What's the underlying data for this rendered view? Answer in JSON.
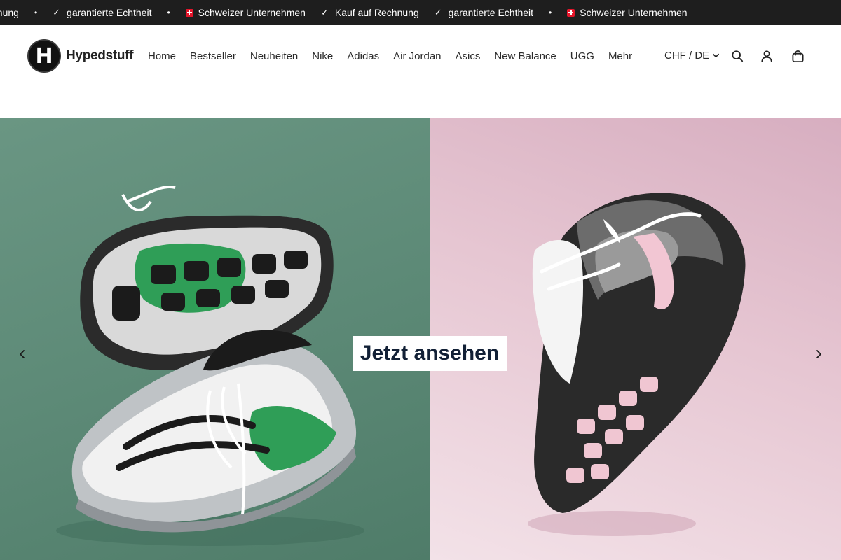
{
  "ticker": {
    "items": [
      {
        "type": "text",
        "text": "hnung"
      },
      {
        "type": "check",
        "text": "garantierte Echtheit"
      },
      {
        "type": "flag",
        "text": "Schweizer Unternehmen"
      },
      {
        "type": "check",
        "text": "Kauf auf Rechnung"
      },
      {
        "type": "check",
        "text": "garantierte Echtheit"
      },
      {
        "type": "flag",
        "text": "Schweizer Unternehmen"
      }
    ],
    "check_glyph": "✓",
    "dot_glyph": "•"
  },
  "header": {
    "logo_letter": "H",
    "logo_text": "Hypedstuff",
    "nav": [
      "Home",
      "Bestseller",
      "Neuheiten",
      "Nike",
      "Adidas",
      "Air Jordan",
      "Asics",
      "New Balance",
      "UGG",
      "Mehr"
    ],
    "locale": "CHF / DE",
    "icons": [
      "search-icon",
      "account-icon",
      "cart-icon"
    ]
  },
  "hero": {
    "cta_label": "Jetzt ansehen",
    "left_bg": "#5d8a77",
    "right_bg": "#e6c6d2",
    "prev_icon": "chevron-left-icon",
    "next_icon": "chevron-right-icon"
  },
  "colors": {
    "ticker_bg": "#1e1e1e",
    "cta_text": "#122036"
  }
}
